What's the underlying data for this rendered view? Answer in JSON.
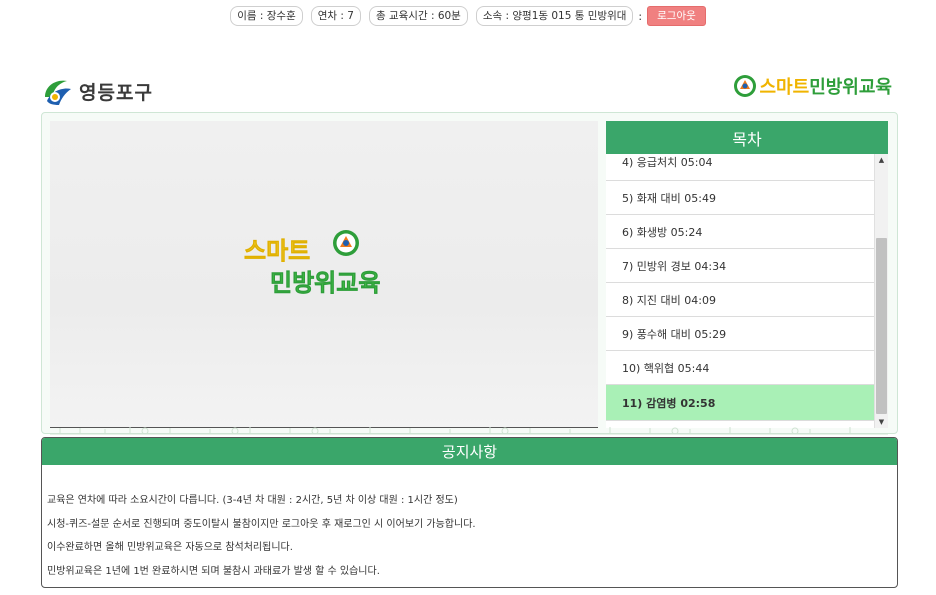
{
  "topbar": {
    "name": "이름 : 장수훈",
    "round": "연차 : 7",
    "total_time": "총 교육시간 : 60분",
    "affiliation": "소속 : 양평1동 015 통 민방위대",
    "separator": ":",
    "logout_label": "로그아웃"
  },
  "header": {
    "left_logo_text": "영등포구",
    "right_logo_text_a": "스마트",
    "right_logo_text_b": "민방위교육"
  },
  "video": {
    "logo_text_a": "스마트",
    "logo_text_b": "민방위교육"
  },
  "toc": {
    "title": "목차",
    "items": [
      "4) 응급처치 05:04",
      "5) 화재 대비 05:49",
      "6) 화생방 05:24",
      "7) 민방위 경보 04:34",
      "8) 지진 대비 04:09",
      "9) 풍수해 대비 05:29",
      "10) 핵위협 05:44",
      "11) 감염병 02:58"
    ],
    "active_index": 7,
    "scroll_position": 0.66
  },
  "notice": {
    "title": "공지사항",
    "lines": [
      "교육은 연차에 따라 소요시간이 다릅니다. (3-4년 차 대원 : 2시간, 5년 차 이상 대원 : 1시간 정도)",
      "시청-퀴즈-설문 순서로 진행되며 중도이탈시 불참이지만 로그아웃 후 재로그인 시 이어보기 가능합니다.",
      "이수완료하면 올해 민방위교육은 자동으로 참석처리됩니다.",
      "민방위교육은 1년에 1번 완료하시면 되며 불참시 과태료가 발생 할 수 있습니다."
    ]
  },
  "colors": {
    "accent_green": "#3aa66a",
    "active_row": "#a9f0b6",
    "logout_bg": "#f08080"
  }
}
